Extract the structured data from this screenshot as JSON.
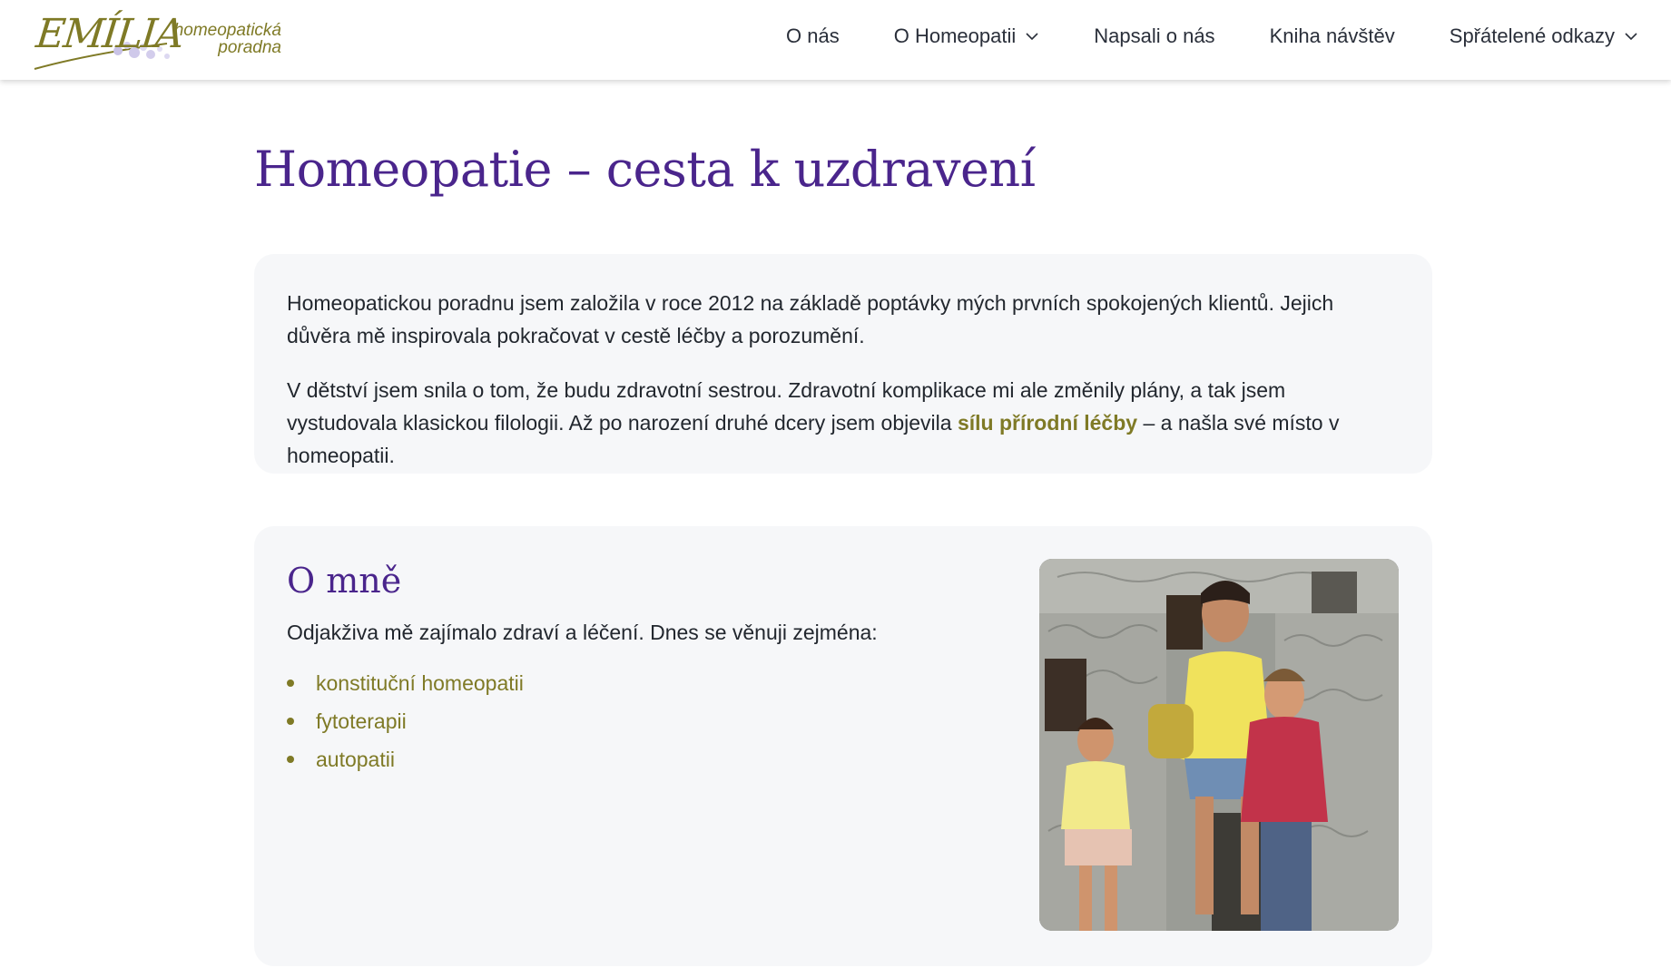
{
  "header": {
    "logo": {
      "script": "EMÍLIA",
      "line1": "homeopatická",
      "line2": "poradna"
    },
    "nav": [
      {
        "label": "O nás",
        "dropdown": false
      },
      {
        "label": "O Homeopatii",
        "dropdown": true
      },
      {
        "label": "Napsali o nás",
        "dropdown": false
      },
      {
        "label": "Kniha návštěv",
        "dropdown": false
      },
      {
        "label": "Spřátelené odkazy",
        "dropdown": true
      }
    ]
  },
  "main": {
    "title": "Homeopatie – cesta k uzdravení",
    "intro_card": {
      "p1": "Homeopatickou poradnu jsem založila v roce 2012 na základě poptávky mých prvních spokojených klientů. Jejich důvěra mě inspirovala pokračovat v cestě léčby a porozumění.",
      "p2_before": "V dětství jsem snila o tom, že budu zdravotní sestrou. Zdravotní komplikace mi ale změnily plány, a tak jsem vystudovala klasickou filologii. Až po narození druhé dcery jsem objevila ",
      "p2_link": "sílu přírodní léčby",
      "p2_after": " – a našla své místo v homeopatii."
    },
    "about": {
      "heading": "O mně",
      "intro": "Odjakživa mě zajímalo zdraví a léčení. Dnes se věnuji zejména:",
      "items": [
        "konstituční homeopatii",
        "fytoterapii",
        "autopatii"
      ]
    }
  },
  "colors": {
    "accent_purple": "#4a258c",
    "accent_olive": "#7f7a26",
    "card_bg": "#f6f7f9"
  }
}
